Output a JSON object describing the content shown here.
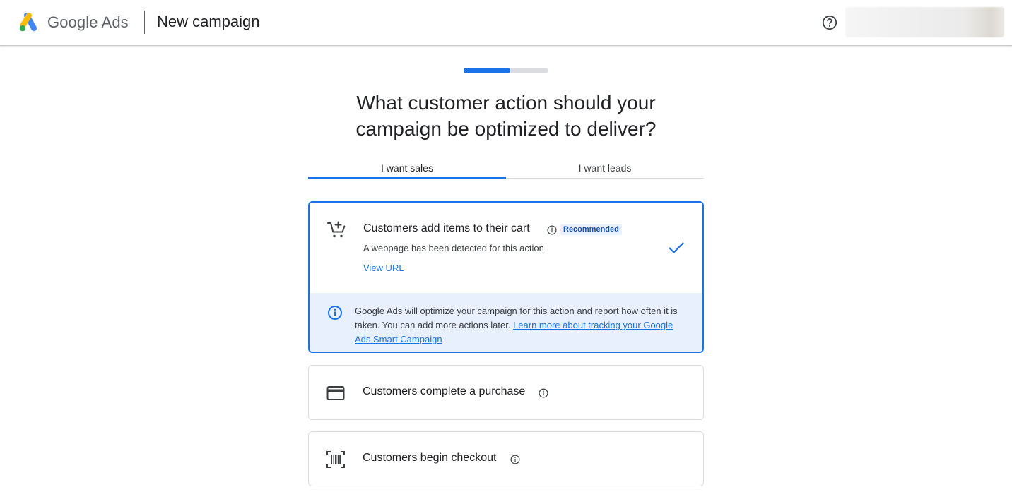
{
  "header": {
    "brand_google": "Google",
    "brand_ads": "Ads",
    "page_title": "New campaign"
  },
  "progress": {
    "fraction": 0.55
  },
  "question": {
    "line1": "What customer action should your",
    "line2": "campaign be optimized to deliver?"
  },
  "tabs": [
    {
      "label": "I want sales",
      "selected": true
    },
    {
      "label": "I want leads",
      "selected": false
    }
  ],
  "options": [
    {
      "title": "Customers add items to their cart",
      "badge": "Recommended",
      "description": "A webpage has been detected for this action",
      "link": "View URL",
      "selected": true,
      "icon": "add-shopping-cart-icon"
    },
    {
      "title": "Customers complete a purchase",
      "selected": false,
      "icon": "credit-card-icon"
    },
    {
      "title": "Customers begin checkout",
      "selected": false,
      "icon": "barcode-scanner-icon"
    }
  ],
  "info_panel": {
    "text": "Google Ads will optimize your campaign for this action and report how often it is taken. You can add more actions later.",
    "link": "Learn more about tracking your Google Ads Smart Campaign"
  },
  "colors": {
    "accent": "#1a73e8",
    "info_bg": "#e8f0fe",
    "badge_text": "#174ea6",
    "track": "#dadce0"
  }
}
